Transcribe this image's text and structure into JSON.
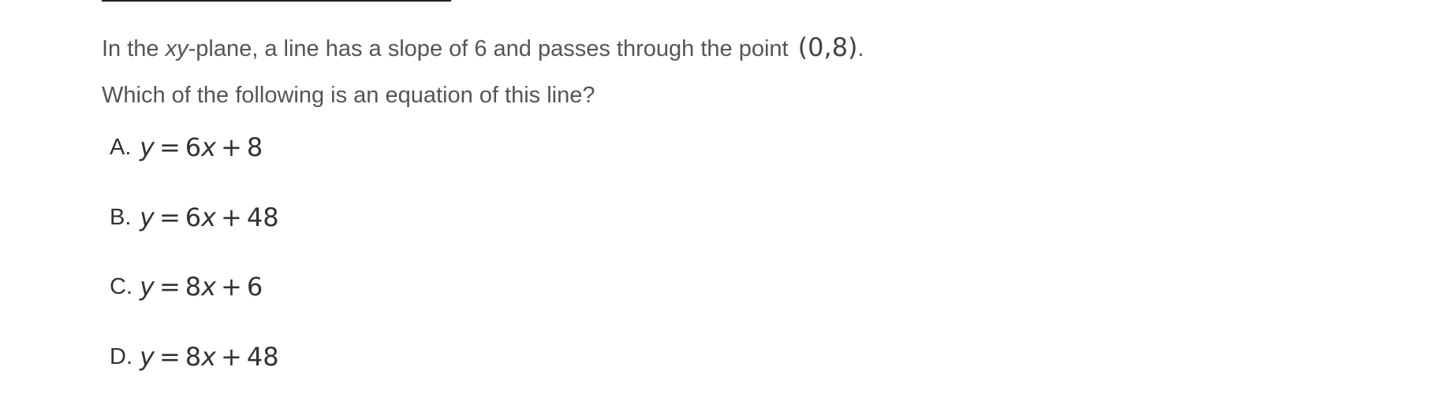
{
  "question": {
    "stem_prefix": "In the ",
    "stem_var": "xy",
    "stem_middle": "-plane, a line has a slope of 6 and passes through the point ",
    "stem_point": "(0,8)",
    "stem_suffix": ".",
    "prompt": "Which of the following is an equation of this line?"
  },
  "choices": [
    {
      "letter": "A.",
      "lhs": "y",
      "rhs_coef": "6",
      "rhs_var": "x",
      "rhs_const": "8"
    },
    {
      "letter": "B.",
      "lhs": "y",
      "rhs_coef": "6",
      "rhs_var": "x",
      "rhs_const": "48"
    },
    {
      "letter": "C.",
      "lhs": "y",
      "rhs_coef": "8",
      "rhs_var": "x",
      "rhs_const": "6"
    },
    {
      "letter": "D.",
      "lhs": "y",
      "rhs_coef": "8",
      "rhs_var": "x",
      "rhs_const": "48"
    }
  ],
  "symbols": {
    "equals": "=",
    "plus": "+"
  }
}
